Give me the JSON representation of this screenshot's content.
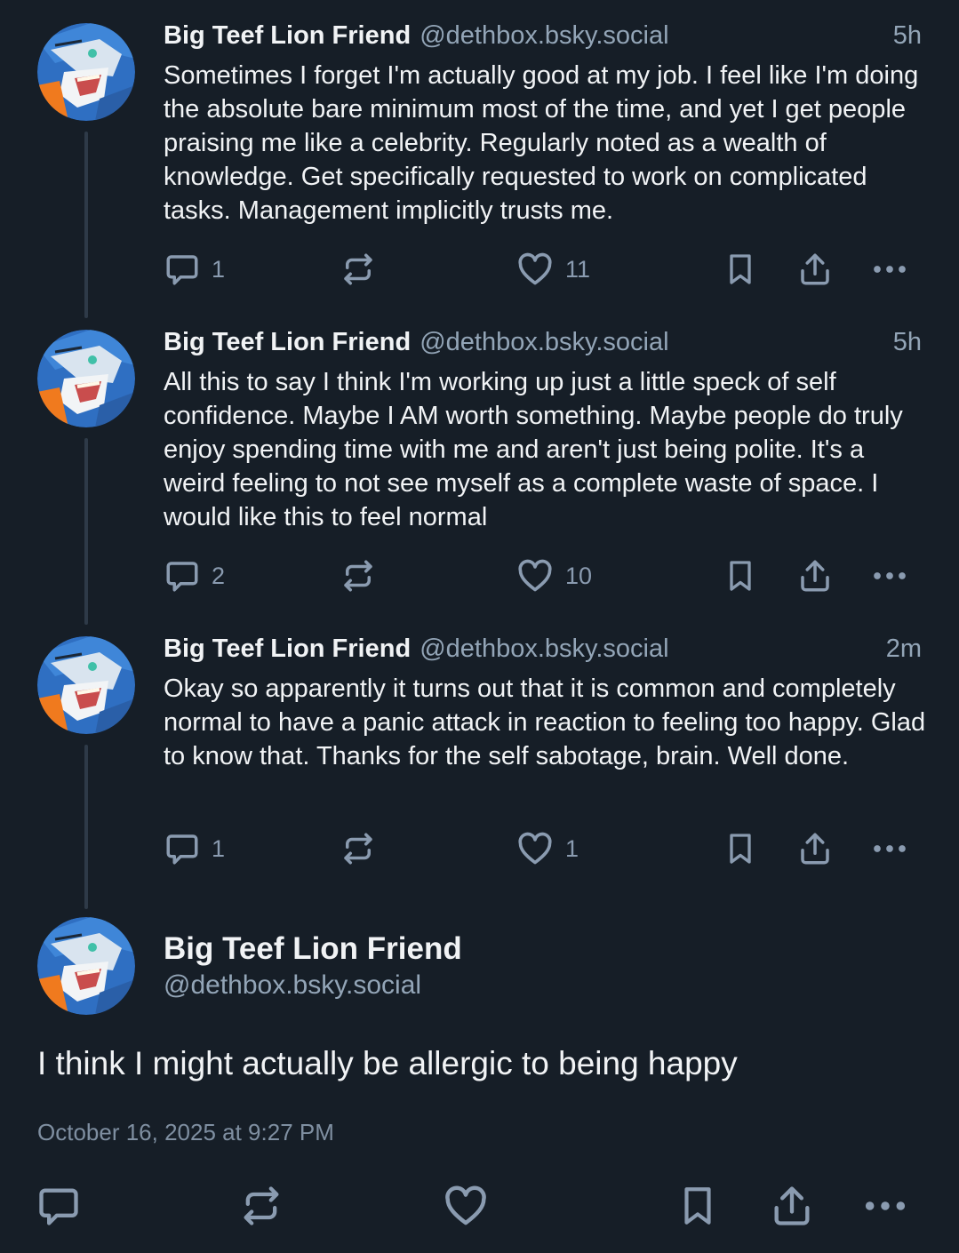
{
  "author": {
    "name": "Big Teef Lion Friend",
    "handle": "@dethbox.bsky.social"
  },
  "thread": [
    {
      "time": "5h",
      "text": "Sometimes I forget I'm actually good at my job. I feel like I'm doing the absolute bare minimum most of the time, and yet I get people praising me like a celebrity. Regularly noted as a wealth of knowledge. Get specifically requested to work on complicated tasks. Management implicitly trusts me.",
      "replies": "1",
      "likes": "11"
    },
    {
      "time": "5h",
      "text": "All this to say I think I'm working up just a little speck of self confidence. Maybe I AM worth something. Maybe people do truly enjoy spending time with me and aren't just being polite. It's a weird feeling to not see myself as a complete waste of space. I would like this to feel normal",
      "replies": "2",
      "likes": "10"
    },
    {
      "time": "2m",
      "text": "Okay so apparently it turns out that it is common and completely normal to have a panic attack in reaction to feeling too happy. Glad to know that. Thanks for the self sabotage, brain. Well done.",
      "replies": "1",
      "likes": "1"
    }
  ],
  "main_post": {
    "text": "I think I might actually be allergic to being happy",
    "date": "October 16, 2025 at 9:27 PM"
  },
  "icons": {
    "reply": "speech-bubble-icon",
    "repost": "repost-arrows-icon",
    "like": "heart-icon",
    "bookmark": "bookmark-icon",
    "share": "share-upload-icon",
    "more": "ellipsis-icon"
  },
  "colors": {
    "background": "#161e27",
    "text": "#f1f3f5",
    "muted": "#93a5b7",
    "icon": "#8a9bb0",
    "thread_line": "#2e3a48"
  }
}
